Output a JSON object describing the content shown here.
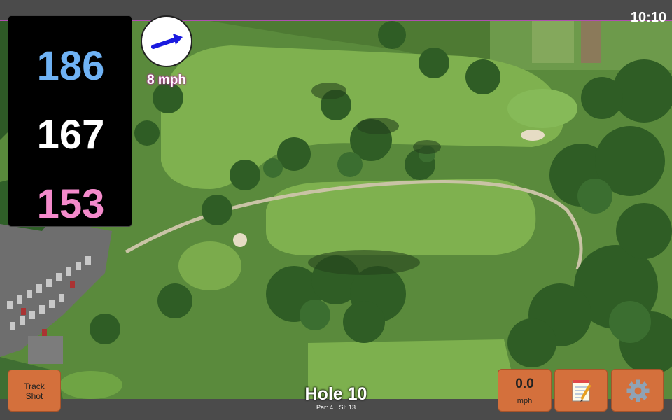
{
  "status_bar": {
    "time": "10:10"
  },
  "distances": {
    "back": "186",
    "middle": "167",
    "front": "153"
  },
  "wind": {
    "speed_label": "8 mph",
    "direction_icon": "arrow-up-right-icon"
  },
  "buttons": {
    "track_shot_line1": "Track",
    "track_shot_line2": "Shot",
    "wind_value": "0.0",
    "wind_unit": "mph",
    "notes_icon": "notepad-icon",
    "settings_icon": "gear-icon"
  },
  "hole": {
    "title": "Hole 10",
    "par": "Par: 4",
    "stroke_index": "SI: 13"
  },
  "colors": {
    "back_distance": "#6fb2f4",
    "middle_distance": "#ffffff",
    "front_distance": "#f48acb",
    "button": "#d4703c",
    "wind_arrow": "#1a1adf",
    "accent_line": "#b04fb0"
  }
}
